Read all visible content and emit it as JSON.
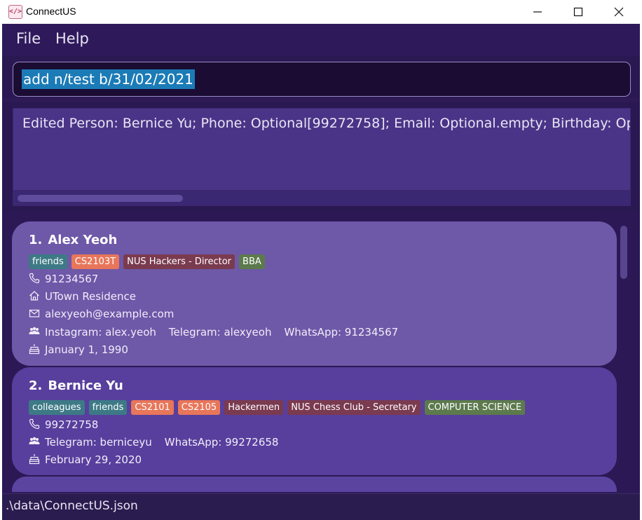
{
  "window": {
    "title": "ConnectUS",
    "app_icon_glyph": "</>",
    "controls": [
      "minimize-icon",
      "maximize-icon",
      "close-icon"
    ]
  },
  "menu": {
    "file": "File",
    "help": "Help"
  },
  "command_box": {
    "value": "add n/test b/31/02/2021"
  },
  "result_display": {
    "text": "Edited Person: Bernice Yu; Phone: Optional[99272758]; Email: Optional.empty; Birthday: Optional"
  },
  "persons": [
    {
      "index": "1.",
      "name": "Alex Yeoh",
      "tags": [
        {
          "label": "friends",
          "color": "#3d7a86"
        },
        {
          "label": "CS2103T",
          "color": "#e8765a"
        },
        {
          "label": "NUS Hackers - Director",
          "color": "#7a3a4f"
        },
        {
          "label": "BBA",
          "color": "#5c7a4c"
        }
      ],
      "phone": "91234567",
      "address": "UTown Residence",
      "email": "alexyeoh@example.com",
      "socials": [
        "Instagram: alex.yeoh",
        "Telegram: alexyeoh",
        "WhatsApp: 91234567"
      ],
      "birthday": "January 1, 1990"
    },
    {
      "index": "2.",
      "name": "Bernice Yu",
      "tags": [
        {
          "label": "colleagues",
          "color": "#3d7a86"
        },
        {
          "label": "friends",
          "color": "#3d7a86"
        },
        {
          "label": "CS2101",
          "color": "#e8765a"
        },
        {
          "label": "CS2105",
          "color": "#e8765a"
        },
        {
          "label": "Hackermen",
          "color": "#7a3a4f"
        },
        {
          "label": "NUS Chess Club - Secretary",
          "color": "#7a3a4f"
        },
        {
          "label": "COMPUTER SCIENCE",
          "color": "#5c7a4c"
        }
      ],
      "phone": "99272758",
      "socials": [
        "Telegram: berniceyu",
        "WhatsApp: 99272658"
      ],
      "birthday": "February 29, 2020"
    }
  ],
  "status_bar": {
    "path": ".\\data\\ConnectUS.json"
  }
}
